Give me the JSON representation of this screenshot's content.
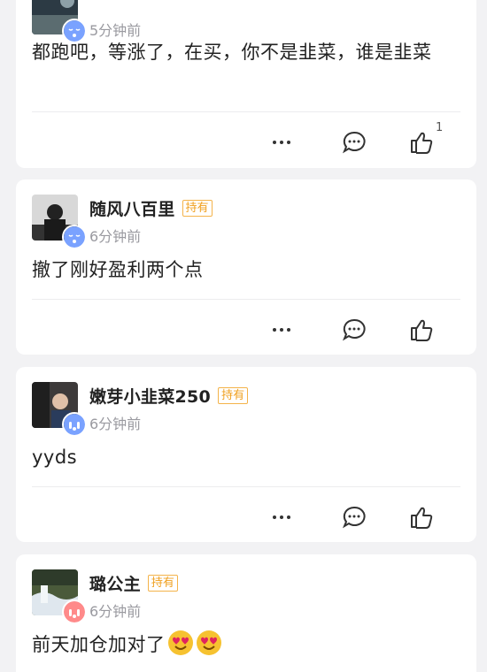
{
  "posts": [
    {
      "time": "5分钟前",
      "content": "都跑吧，等涨了，在买，你不是韭菜，谁是韭菜",
      "like_count": "1"
    },
    {
      "username": "随风八百里",
      "tag": "持有",
      "time": "6分钟前",
      "content": "撤了刚好盈利两个点"
    },
    {
      "username": "嫩芽小韭菜250",
      "tag": "持有",
      "time": "6分钟前",
      "content": "yyds"
    },
    {
      "username": "璐公主",
      "tag": "持有",
      "time": "6分钟前",
      "content": "前天加仓加对了"
    }
  ],
  "icons": {
    "more": "more-icon",
    "comment": "comment-icon",
    "like": "thumbs-up-icon",
    "emoji": "heart-eyes-emoji"
  },
  "colors": {
    "tag": "#f0a020",
    "background": "#f2f2f4",
    "muted": "#9a9aa0"
  }
}
